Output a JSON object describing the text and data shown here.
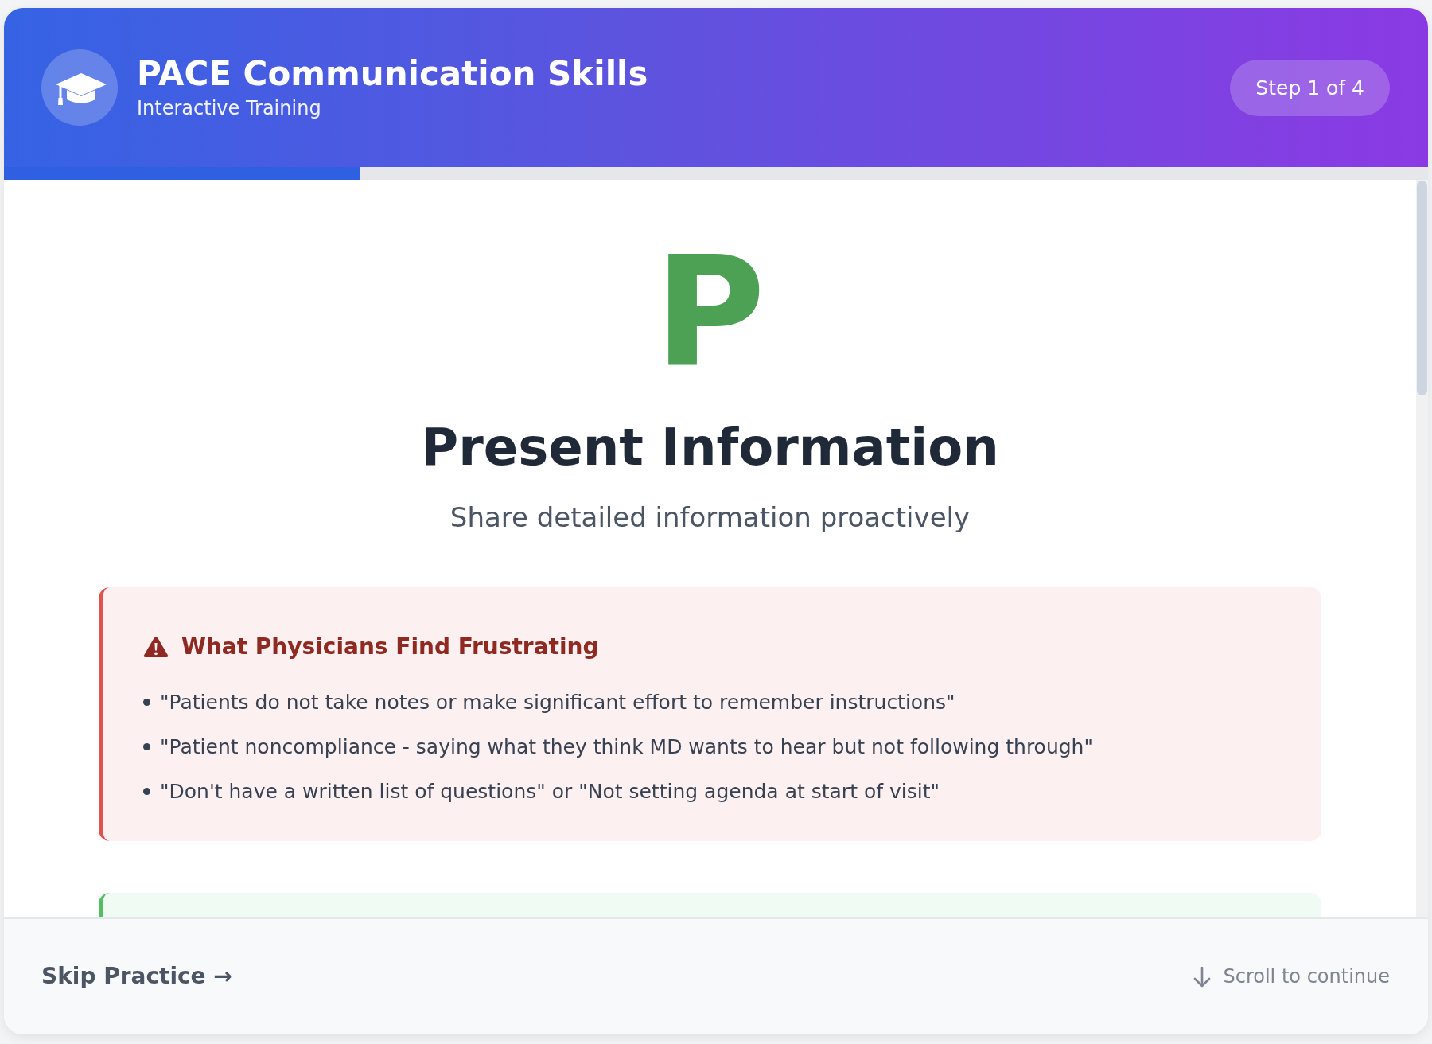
{
  "header": {
    "title": "PACE Communication Skills",
    "subtitle": "Interactive Training",
    "step_badge": "Step 1 of 4"
  },
  "progress": {
    "level": 0.25
  },
  "step": {
    "letter": "P",
    "title": "Present Information",
    "subtitle": "Share detailed information proactively"
  },
  "panels": [
    {
      "kind": "warning",
      "title": "What Physicians Find Frustrating",
      "items": [
        "\"Patients do not take notes or make significant effort to remember instructions\"",
        "\"Patient noncompliance - saying what they think MD wants to hear but not following through\"",
        "\"Don't have a written list of questions\" or \"Not setting agenda at start of visit\""
      ]
    },
    {
      "kind": "tip"
    }
  ],
  "footer": {
    "skip_button": "Skip Practice →",
    "scroll_hint": "Scroll to continue"
  }
}
